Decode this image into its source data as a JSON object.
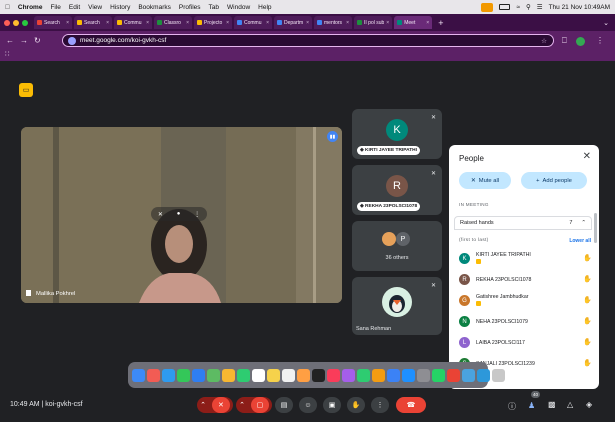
{
  "menubar": {
    "apple": "",
    "app": "Chrome",
    "items": [
      "File",
      "Edit",
      "View",
      "History",
      "Bookmarks",
      "Profiles",
      "Tab",
      "Window",
      "Help"
    ],
    "clock": "Thu 21 Nov  10:49AM"
  },
  "tabs": [
    {
      "label": "Search",
      "color": "#ea4335",
      "active": false
    },
    {
      "label": "Search",
      "color": "#fbbc04",
      "active": false
    },
    {
      "label": "Commu",
      "color": "#fbbc04",
      "active": false
    },
    {
      "label": "Classro",
      "color": "#1e8e3e",
      "active": false
    },
    {
      "label": "Projecto",
      "color": "#fbbc04",
      "active": false
    },
    {
      "label": "Commu",
      "color": "#4285f4",
      "active": false
    },
    {
      "label": "Departm",
      "color": "#4285f4",
      "active": false
    },
    {
      "label": "mentors",
      "color": "#4285f4",
      "active": false
    },
    {
      "label": "II pol sub",
      "color": "#1e8e3e",
      "active": false
    },
    {
      "label": "Meet",
      "color": "#00897b",
      "active": true
    }
  ],
  "address": {
    "url": "meet.google.com/koi-gvkh-csf",
    "apps_icon": "apps-grid-icon"
  },
  "main_video": {
    "name": "Mallika Pokhrel"
  },
  "tiles": [
    {
      "initial": "K",
      "name": "KIRTI JAYEE TRIPATHI",
      "bg": "#00897b"
    },
    {
      "initial": "R",
      "name": "REKHA 23POLSCI1078",
      "bg": "#795548"
    },
    {
      "initial": "P",
      "label": "36 others",
      "bg": "#5f6368"
    },
    {
      "name": "Sana Rehman"
    }
  ],
  "people": {
    "title": "People",
    "mute_all": "Mute all",
    "add_people": "Add people",
    "in_meeting": "IN MEETING",
    "raised_hands": "Raised hands",
    "raised_count": "7",
    "order": "(first to last)",
    "lower_all": "Lower all",
    "participants": [
      {
        "initial": "K",
        "name": "KIRTI JAYEE TRIPATHI",
        "color": "#00897b",
        "badge": true
      },
      {
        "initial": "R",
        "name": "REKHA 23POLSCI1078",
        "color": "#795548",
        "badge": false
      },
      {
        "initial": "G",
        "name": "Gatishree Jambhudkar",
        "color": "#c9772b",
        "badge": true
      },
      {
        "initial": "N",
        "name": "NEHA 23POLSCI1079",
        "color": "#0b8043",
        "badge": false
      },
      {
        "initial": "L",
        "name": "LAIBA 23POLSCI117",
        "color": "#8e63ce",
        "badge": false
      },
      {
        "initial": "S",
        "name": "SANJALI 23POLSCI1239",
        "color": "#1e7b34",
        "badge": false
      }
    ]
  },
  "bottom": {
    "time_code": "10:49 AM  |  koi-gvkh-csf",
    "participant_count": "40"
  },
  "colors": {
    "accent_blue": "#c2e7ff",
    "meet_bg": "#202124",
    "end_call": "#ea4335"
  }
}
